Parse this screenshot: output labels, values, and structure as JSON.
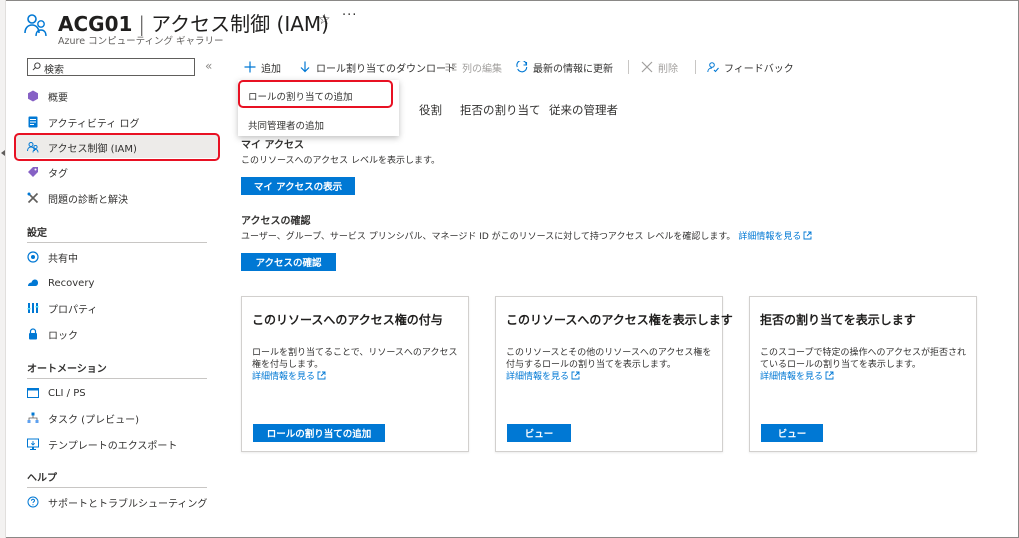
{
  "header": {
    "resource_name": "ACG01",
    "separator": "|",
    "page_name": "アクセス制御 (IAM)",
    "subtitle": "Azure コンピューティング ギャラリー",
    "more": "···"
  },
  "sidebar": {
    "search_placeholder": "検索",
    "collapse": "«",
    "items": [
      {
        "label": "概要",
        "icon": "overview-icon"
      },
      {
        "label": "アクティビティ ログ",
        "icon": "activity-log-icon"
      },
      {
        "label": "アクセス制御 (IAM)",
        "icon": "iam-icon"
      },
      {
        "label": "タグ",
        "icon": "tag-icon"
      },
      {
        "label": "問題の診断と解決",
        "icon": "diagnose-icon"
      }
    ],
    "section_settings": "設定",
    "settings_items": [
      {
        "label": "共有中",
        "icon": "sharing-icon"
      },
      {
        "label": "Recovery",
        "icon": "recovery-icon"
      },
      {
        "label": "プロパティ",
        "icon": "properties-icon"
      },
      {
        "label": "ロック",
        "icon": "lock-icon"
      }
    ],
    "section_automation": "オートメーション",
    "automation_items": [
      {
        "label": "CLI / PS",
        "icon": "cli-icon"
      },
      {
        "label": "タスク (プレビュー)",
        "icon": "tasks-icon"
      },
      {
        "label": "テンプレートのエクスポート",
        "icon": "export-template-icon"
      }
    ],
    "section_help": "ヘルプ",
    "help_items": [
      {
        "label": "サポートとトラブルシューティング",
        "icon": "help-icon"
      }
    ]
  },
  "toolbar": {
    "add": "追加",
    "download": "ロール割り当てのダウンロード",
    "edit_columns": "列の編集",
    "refresh": "最新の情報に更新",
    "delete": "削除",
    "feedback": "フィードバック"
  },
  "dropdown": {
    "add_role_assignment": "ロールの割り当ての追加",
    "add_coadmin": "共同管理者の追加"
  },
  "tabs": {
    "roles": "役割",
    "deny_assignments": "拒否の割り当て",
    "classic_admins": "従来の管理者"
  },
  "my_access": {
    "heading": "マイ アクセス",
    "desc": "このリソースへのアクセス レベルを表示します。",
    "button": "マイ アクセスの表示"
  },
  "check_access": {
    "heading": "アクセスの確認",
    "desc": "ユーザー、グループ、サービス プリンシパル、マネージド ID がこのリソースに対して持つアクセス レベルを確認します。",
    "link": "詳細情報を見る",
    "button": "アクセスの確認"
  },
  "cards": [
    {
      "title": "このリソースへのアクセス権の付与",
      "desc": "ロールを割り当てることで、リソースへのアクセス権を付与します。",
      "link": "詳細情報を見る",
      "button": "ロールの割り当ての追加"
    },
    {
      "title": "このリソースへのアクセス権を表示します",
      "desc": "このリソースとその他のリソースへのアクセス権を付与するロールの割り当てを表示します。",
      "link": "詳細情報を見る",
      "button": "ビュー"
    },
    {
      "title": "拒否の割り当てを表示します",
      "desc": "このスコープで特定の操作へのアクセスが拒否されているロールの割り当てを表示します。",
      "link": "詳細情報を見る",
      "button": "ビュー"
    }
  ],
  "colors": {
    "accent": "#0078d4",
    "highlight": "#e81123",
    "selected_bg": "#edebe9"
  }
}
